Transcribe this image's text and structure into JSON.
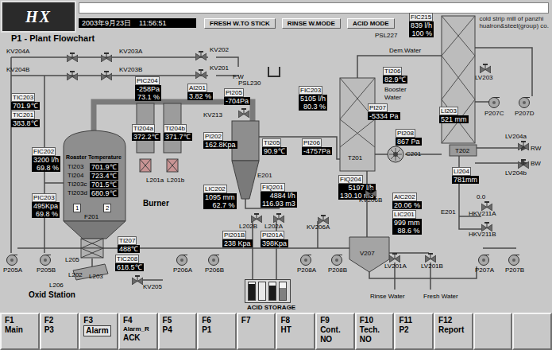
{
  "header": {
    "logo": "HX",
    "date": "2003年9月23日",
    "time": "11:56:51",
    "modes": [
      "FRESH W.TO STICK",
      "RINSE W.MODE",
      "ACID MODE"
    ],
    "company": [
      "cold strip mill of panzhi",
      "hualron&steel(group) co."
    ]
  },
  "title": "P1 - Plant Flowchart",
  "readings": [
    {
      "tag": "TIC203",
      "values": [
        "701.9℃"
      ]
    },
    {
      "tag": "TIC201",
      "values": [
        "383.8℃"
      ]
    },
    {
      "tag": "FIC202",
      "values": [
        "3200 l/h",
        "69.8 %"
      ]
    },
    {
      "tag": "PIC203",
      "values": [
        "495Kpa",
        "69.8 %"
      ]
    },
    {
      "tag": "PIC204",
      "values": [
        "-258Pa",
        "73.1 %"
      ]
    },
    {
      "tag": "AI201",
      "values": [
        "3.82 %"
      ]
    },
    {
      "tag": "PI205",
      "values": [
        "-704Pa"
      ]
    },
    {
      "tag": "TI204a",
      "values": [
        "372.2℃"
      ]
    },
    {
      "tag": "TI204b",
      "values": [
        "371.7℃"
      ]
    },
    {
      "tag": "PI202",
      "values": [
        "162.8Kpa"
      ]
    },
    {
      "tag": "LIC202",
      "values": [
        "1095 mm",
        "62.7 %"
      ]
    },
    {
      "tag": "TI205",
      "values": [
        "90.9℃"
      ]
    },
    {
      "tag": "PI206",
      "values": [
        "-4757Pa"
      ]
    },
    {
      "tag": "FIQ201",
      "values": [
        "4884 l/h",
        "116.93 m3"
      ]
    },
    {
      "tag": "PI201B",
      "values": [
        "238 Kpa"
      ]
    },
    {
      "tag": "PI201A",
      "values": [
        "398Kpa"
      ]
    },
    {
      "tag": "FIC203",
      "values": [
        "5105 l/h",
        "80.3 %"
      ]
    },
    {
      "tag": "FIC215",
      "values": [
        "839 l/h",
        "100 %"
      ]
    },
    {
      "tag": "TI206",
      "values": [
        "82.9℃"
      ]
    },
    {
      "tag": "PI207",
      "values": [
        "-5334 Pa"
      ]
    },
    {
      "tag": "LI203",
      "values": [
        "521 mm"
      ]
    },
    {
      "tag": "PI208",
      "values": [
        "867 Pa"
      ]
    },
    {
      "tag": "FIQ204",
      "values": [
        "5197 l/h",
        "130.10 m3"
      ]
    },
    {
      "tag": "AIC202",
      "values": [
        "20.06 %"
      ]
    },
    {
      "tag": "LIC201",
      "values": [
        "999 mm",
        "88.6 %"
      ]
    },
    {
      "tag": "LI204",
      "values": [
        "781mm"
      ]
    },
    {
      "tag": "TI207",
      "values": [
        "488℃"
      ]
    },
    {
      "tag": "TIC208",
      "values": [
        "618.5℃"
      ]
    }
  ],
  "labels": [
    {
      "text": "KV204A",
      "kind": "valve"
    },
    {
      "text": "KV203A",
      "kind": "valve"
    },
    {
      "text": "KV204B",
      "kind": "valve"
    },
    {
      "text": "KV203B",
      "kind": "valve"
    },
    {
      "text": "KV202",
      "kind": "valve"
    },
    {
      "text": "KV201",
      "kind": "valve"
    },
    {
      "text": "KV213",
      "kind": "valve"
    },
    {
      "text": "LV203",
      "kind": "valve"
    },
    {
      "text": "LV204a",
      "kind": "valve"
    },
    {
      "text": "LV204b",
      "kind": "valve"
    },
    {
      "text": "HKV211A",
      "kind": "valve"
    },
    {
      "text": "HKV211B",
      "kind": "valve"
    },
    {
      "text": "KV206B",
      "kind": "valve"
    },
    {
      "text": "KV206A",
      "kind": "valve"
    },
    {
      "text": "L202B",
      "kind": "valve"
    },
    {
      "text": "L202A",
      "kind": "valve"
    },
    {
      "text": "KV205",
      "kind": "valve"
    },
    {
      "text": "LV201A",
      "kind": "valve"
    },
    {
      "text": "LV201B",
      "kind": "valve"
    },
    {
      "text": "P205A",
      "kind": "pump"
    },
    {
      "text": "P205B",
      "kind": "pump"
    },
    {
      "text": "P206A",
      "kind": "pump"
    },
    {
      "text": "P206B",
      "kind": "pump"
    },
    {
      "text": "P208A",
      "kind": "pump"
    },
    {
      "text": "P208B",
      "kind": "pump"
    },
    {
      "text": "P207A",
      "kind": "pump"
    },
    {
      "text": "P207B",
      "kind": "pump"
    },
    {
      "text": "P207C",
      "kind": "pump"
    },
    {
      "text": "P207D",
      "kind": "pump"
    },
    {
      "text": "C201",
      "kind": "compressor"
    },
    {
      "text": "F.W",
      "kind": "plain"
    },
    {
      "text": "PSL230",
      "kind": "plain"
    },
    {
      "text": "PSL227",
      "kind": "plain"
    },
    {
      "text": "Dem.Water",
      "kind": "plain"
    },
    {
      "text": "Booster Water",
      "kind": "plain"
    },
    {
      "text": "T201",
      "kind": "plain"
    },
    {
      "text": "T202",
      "kind": "plain"
    },
    {
      "text": "E201",
      "kind": "plain"
    },
    {
      "text": "F201",
      "kind": "plain"
    },
    {
      "text": "Burner",
      "kind": "heading"
    },
    {
      "text": "L201a",
      "kind": "plain"
    },
    {
      "text": "L201b",
      "kind": "plain"
    },
    {
      "text": "L205",
      "kind": "plain"
    },
    {
      "text": "L202",
      "kind": "plain"
    },
    {
      "text": "L206",
      "kind": "plain"
    },
    {
      "text": "L203",
      "kind": "plain"
    },
    {
      "text": "Oxid Station",
      "kind": "heading"
    },
    {
      "text": "RW",
      "kind": "plain"
    },
    {
      "text": "BW",
      "kind": "plain"
    },
    {
      "text": "E201",
      "kind": "plain"
    },
    {
      "text": "0.0",
      "kind": "plain"
    },
    {
      "text": "V207",
      "kind": "plain"
    },
    {
      "text": "Rinse Water",
      "kind": "plain"
    },
    {
      "text": "Fresh Water",
      "kind": "plain"
    }
  ],
  "roaster": {
    "title": "Roaster Temperature",
    "rows": [
      {
        "tag": "TI203",
        "value": "701.9℃"
      },
      {
        "tag": "TI204",
        "value": "723.4℃"
      },
      {
        "tag": "TI203c",
        "value": "701.5℃"
      },
      {
        "tag": "TI203d",
        "value": "680.9℃"
      }
    ],
    "zones": [
      "1",
      "2"
    ]
  },
  "acid_storage": {
    "label": "ACID STORAGE",
    "tanks": [
      {
        "level": 0.9,
        "color": "#1a1a1a"
      },
      {
        "level": 0.95,
        "color": "#e8e8e8"
      },
      {
        "level": 0.8,
        "color": "#1a1a1a"
      },
      {
        "level": 0.7,
        "color": "#808080"
      }
    ]
  },
  "function_keys": [
    {
      "key": "F1",
      "lines": [
        "Main"
      ],
      "highlighted": false
    },
    {
      "key": "F2",
      "lines": [
        "P3"
      ],
      "highlighted": false
    },
    {
      "key": "F3",
      "lines": [
        "Alarm"
      ],
      "highlighted": true
    },
    {
      "key": "F4",
      "lines": [
        "Alarm_R",
        "ACK"
      ],
      "highlighted": false
    },
    {
      "key": "F5",
      "lines": [
        "P4"
      ],
      "highlighted": false
    },
    {
      "key": "F6",
      "lines": [
        "P1"
      ],
      "highlighted": false
    },
    {
      "key": "F7",
      "lines": [],
      "highlighted": false
    },
    {
      "key": "F8",
      "lines": [
        "HT"
      ],
      "highlighted": false
    },
    {
      "key": "F9",
      "lines": [
        "Cont.",
        "NO"
      ],
      "highlighted": false
    },
    {
      "key": "F10",
      "lines": [
        "Tech.",
        "NO"
      ],
      "highlighted": false
    },
    {
      "key": "F11",
      "lines": [
        "P2"
      ],
      "highlighted": false
    },
    {
      "key": "F12",
      "lines": [
        "Report"
      ],
      "highlighted": false
    },
    {
      "key": "",
      "lines": [],
      "highlighted": false
    },
    {
      "key": "",
      "lines": [],
      "highlighted": false
    }
  ]
}
